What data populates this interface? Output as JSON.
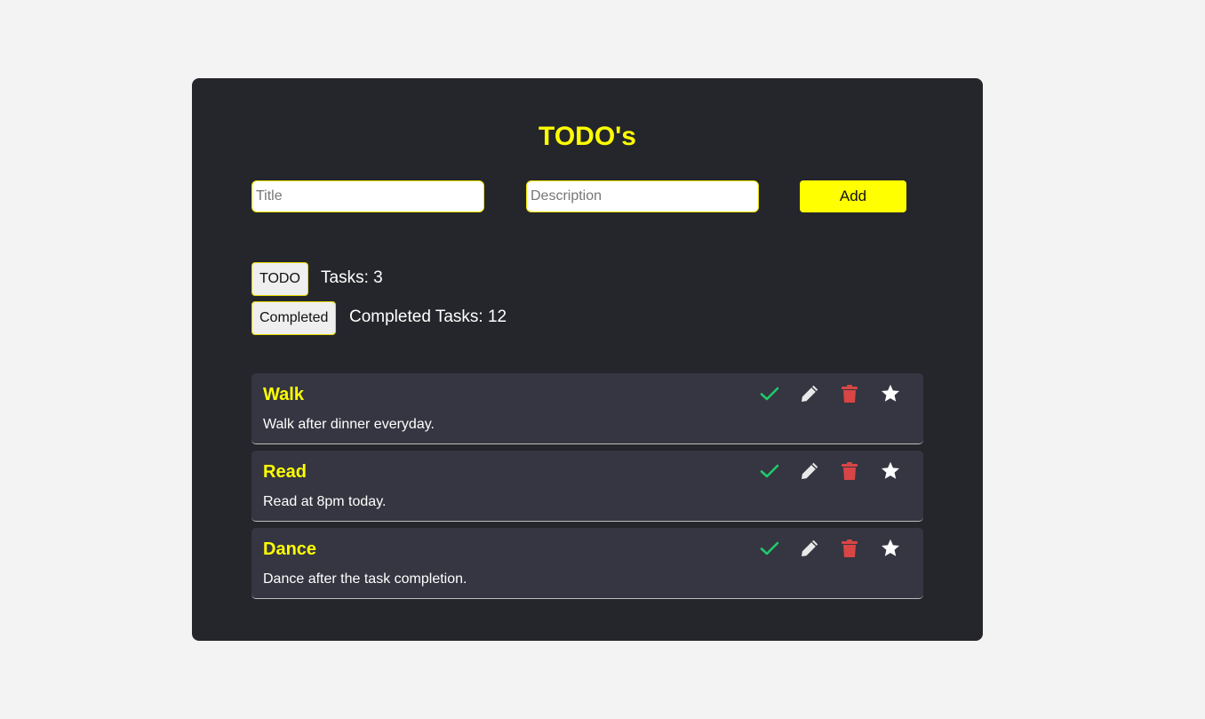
{
  "header": {
    "title": "TODO's"
  },
  "form": {
    "title_placeholder": "Title",
    "description_placeholder": "Description",
    "add_label": "Add"
  },
  "filters": {
    "todo_label": "TODO",
    "todo_count_text": "Tasks: 3",
    "completed_label": "Completed",
    "completed_count_text": "Completed Tasks: 12"
  },
  "tasks": [
    {
      "title": "Walk",
      "description": "Walk after dinner everyday."
    },
    {
      "title": "Read",
      "description": "Read at 8pm today."
    },
    {
      "title": "Dance",
      "description": "Dance after the task completion."
    }
  ],
  "colors": {
    "accent": "#ffff00",
    "card_bg": "#25262b",
    "task_bg": "#353641",
    "check": "#1fca6b",
    "delete": "#d94545"
  },
  "icons": [
    "check-icon",
    "pencil-icon",
    "trash-icon",
    "star-icon"
  ]
}
